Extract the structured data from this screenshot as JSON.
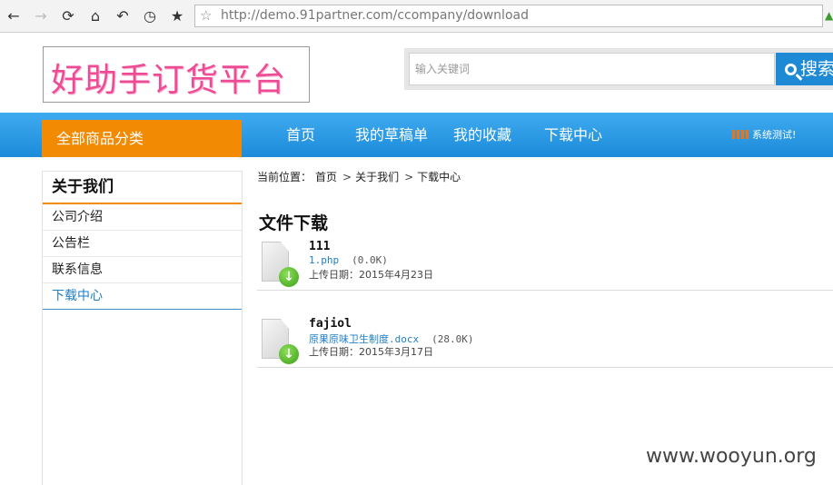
{
  "browser": {
    "back": "←",
    "forward": "→",
    "reload": "⟳",
    "home": "⌂",
    "undo": "↶",
    "history": "◷",
    "bookmark": "★",
    "star": "☆",
    "url": "http://demo.91partner.com/ccompany/download"
  },
  "header": {
    "logo_text": "好助手订货平台",
    "search_placeholder": "输入关键词",
    "search_button": "搜索"
  },
  "nav": {
    "category_button": "全部商品分类",
    "items": [
      "首页",
      "我的草稿单",
      "我的收藏",
      "下载中心"
    ],
    "system_test": "系统测试!"
  },
  "sidebar": {
    "title": "关于我们",
    "items": [
      {
        "label": "公司介绍",
        "active": false
      },
      {
        "label": "公告栏",
        "active": false
      },
      {
        "label": "联系信息",
        "active": false
      },
      {
        "label": "下载中心",
        "active": true
      }
    ]
  },
  "breadcrumb": {
    "prefix": "当前位置：",
    "items": [
      "首页",
      "关于我们",
      "下载中心"
    ]
  },
  "main": {
    "title": "文件下载",
    "files": [
      {
        "name": "111",
        "file": "1.php",
        "size": "(0.0K)",
        "date": "上传日期：2015年4月23日"
      },
      {
        "name": "fajiol",
        "file": "原果原味卫生制度.docx",
        "size": "(28.0K)",
        "date": "上传日期：2015年3月17日"
      }
    ]
  },
  "watermark": "www.wooyun.org",
  "colors": {
    "nav_blue": "#1e8ad6",
    "category_orange": "#f28a03",
    "link_blue": "#1e7ec8",
    "logo_pink": "#ee4b95"
  }
}
